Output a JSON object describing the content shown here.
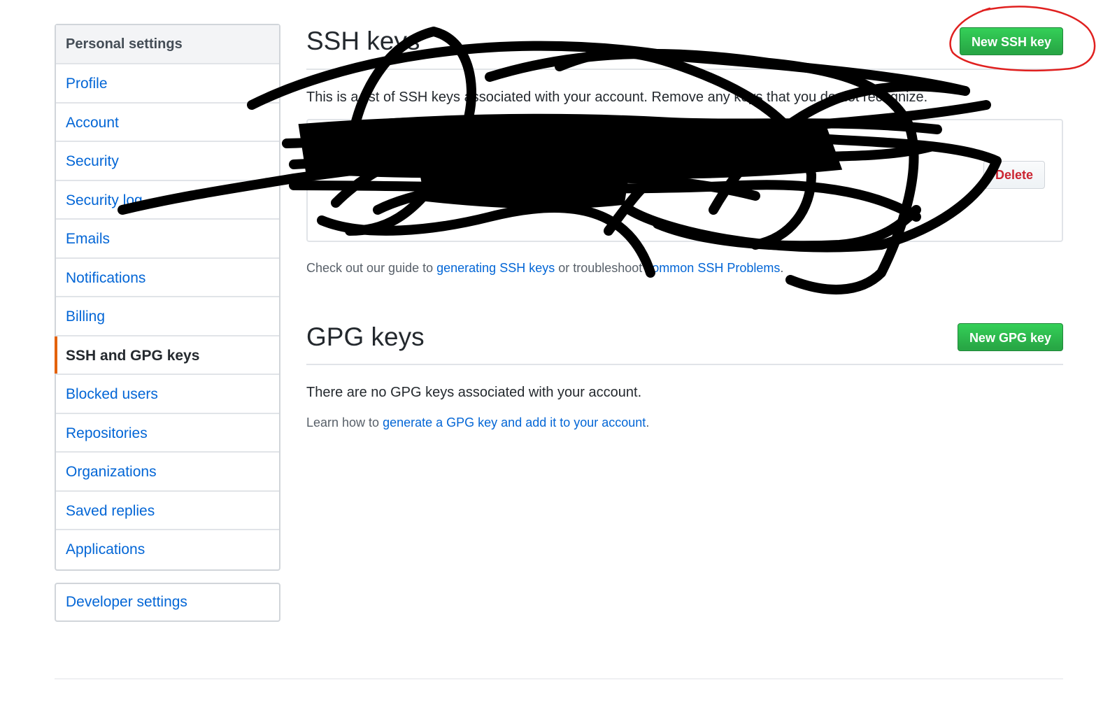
{
  "sidebar": {
    "heading": "Personal settings",
    "items": [
      {
        "label": "Profile"
      },
      {
        "label": "Account"
      },
      {
        "label": "Security"
      },
      {
        "label": "Security log"
      },
      {
        "label": "Emails"
      },
      {
        "label": "Notifications"
      },
      {
        "label": "Billing"
      },
      {
        "label": "SSH and GPG keys",
        "selected": true
      },
      {
        "label": "Blocked users"
      },
      {
        "label": "Repositories"
      },
      {
        "label": "Organizations"
      },
      {
        "label": "Saved replies"
      },
      {
        "label": "Applications"
      }
    ],
    "developer_settings": "Developer settings"
  },
  "ssh": {
    "title": "SSH keys",
    "new_button": "New SSH key",
    "description": "This is a list of SSH keys associated with your account. Remove any keys that you do not recognize.",
    "delete_button": "Delete",
    "guide_prefix": "Check out our guide to ",
    "guide_link": "generating SSH keys",
    "guide_middle": " or troubleshoot ",
    "guide_link2": "common SSH Problems",
    "guide_suffix": "."
  },
  "gpg": {
    "title": "GPG keys",
    "new_button": "New GPG key",
    "empty_text": "There are no GPG keys associated with your account.",
    "learn_prefix": "Learn how to ",
    "learn_link": "generate a GPG key and add it to your account",
    "learn_suffix": "."
  },
  "colors": {
    "link": "#0366d6",
    "primary_green": "#28a745",
    "danger_red": "#cb2431",
    "selected_accent": "#e36209",
    "annotation_red": "#e0201f"
  }
}
